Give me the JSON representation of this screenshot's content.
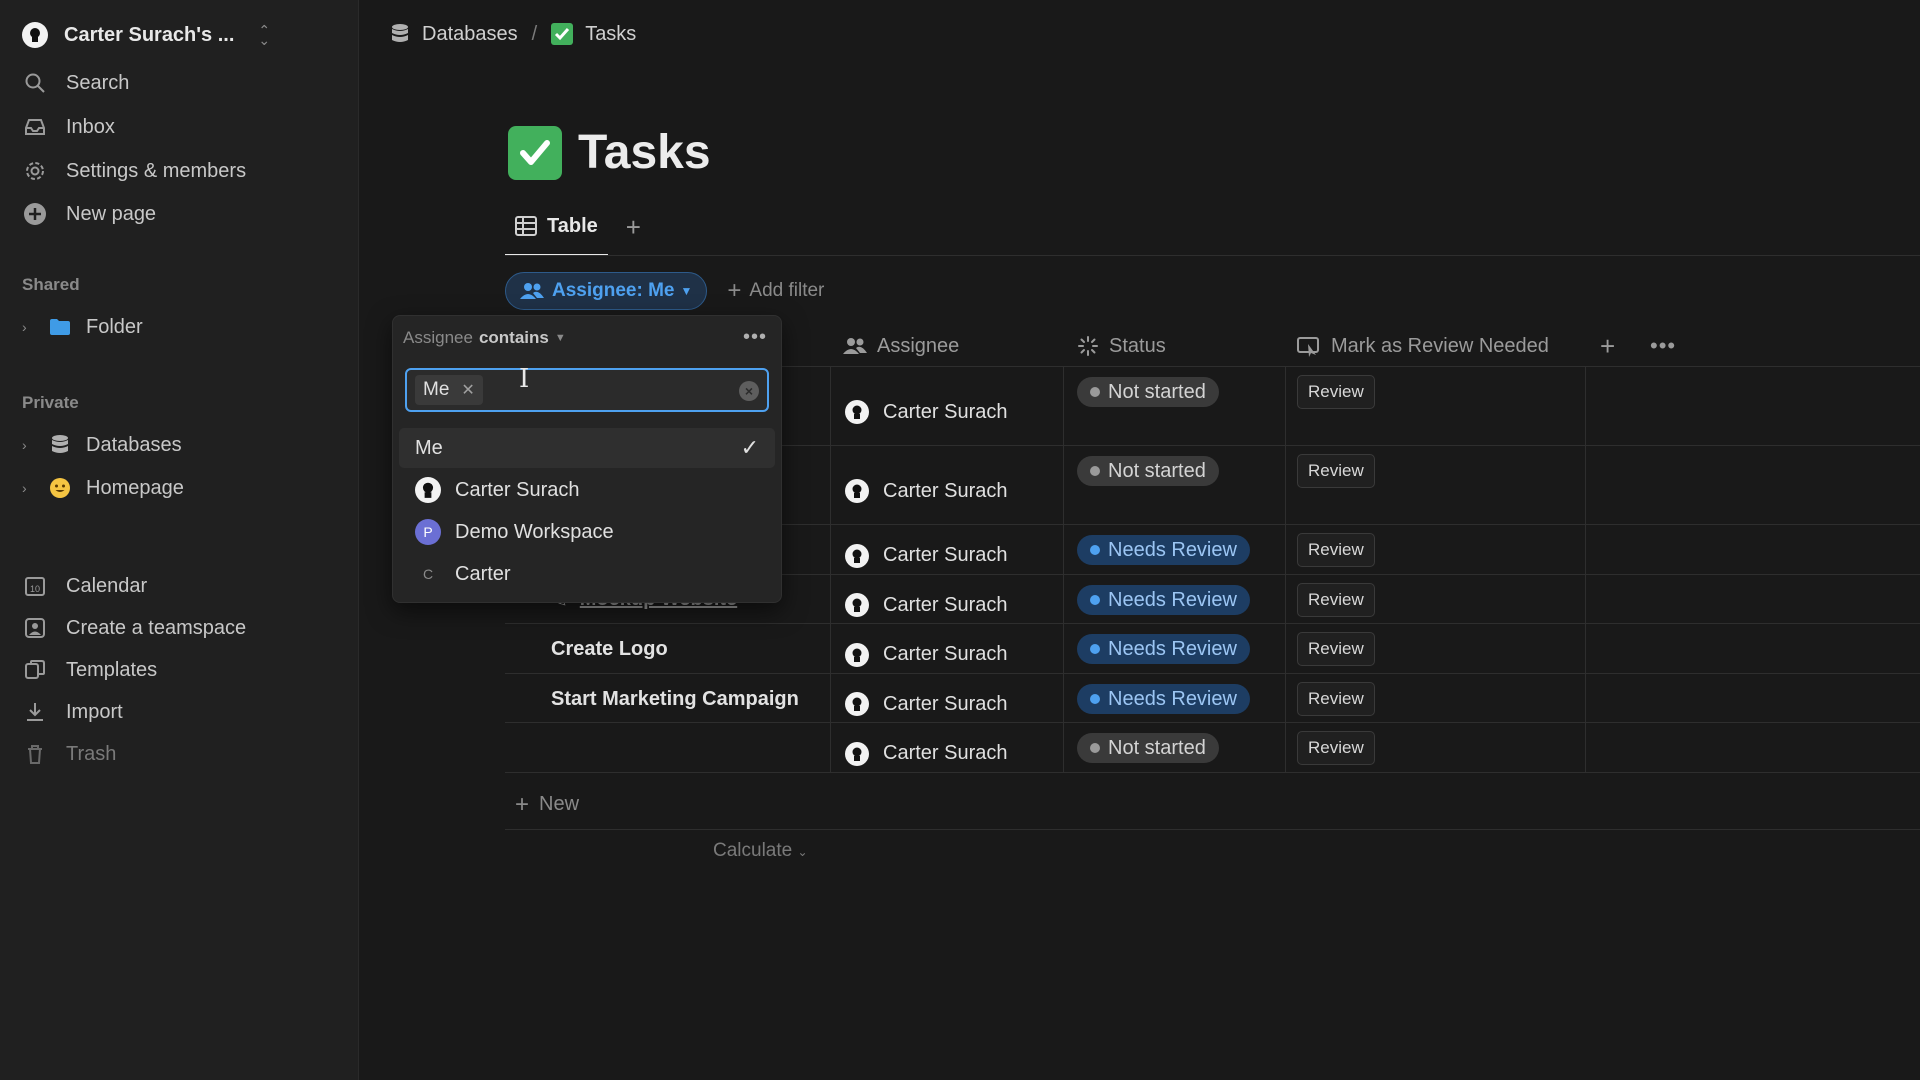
{
  "sidebar": {
    "workspace_name": "Carter Surach's ...",
    "nav": [
      {
        "label": "Search",
        "icon": "search-icon"
      },
      {
        "label": "Inbox",
        "icon": "inbox-icon"
      },
      {
        "label": "Settings & members",
        "icon": "gear-icon"
      },
      {
        "label": "New page",
        "icon": "plus-circle-icon"
      }
    ],
    "shared_label": "Shared",
    "shared_items": [
      {
        "label": "Folder",
        "icon": "folder-icon"
      }
    ],
    "private_label": "Private",
    "private_items": [
      {
        "label": "Databases",
        "icon": "database-icon"
      },
      {
        "label": "Homepage",
        "icon": "smiley-icon"
      }
    ],
    "bottom_nav": [
      {
        "label": "Calendar",
        "icon": "calendar-icon"
      },
      {
        "label": "Create a teamspace",
        "icon": "teamspace-icon"
      },
      {
        "label": "Templates",
        "icon": "templates-icon"
      },
      {
        "label": "Import",
        "icon": "import-icon"
      },
      {
        "label": "Trash",
        "icon": "trash-icon"
      }
    ]
  },
  "breadcrumb": {
    "items": [
      "Databases",
      "Tasks"
    ],
    "separator": "/"
  },
  "page": {
    "title": "Tasks",
    "tabs": [
      {
        "label": "Table"
      }
    ],
    "filter_chip": "Assignee: Me",
    "add_filter": "Add filter"
  },
  "table": {
    "columns": [
      "Assignee",
      "Status",
      "Mark as Review Needed"
    ],
    "rows": [
      {
        "name": "",
        "assignee": "Carter Surach",
        "status": "Not started",
        "review": "Review"
      },
      {
        "name": "",
        "assignee": "Carter Surach",
        "status": "Not started",
        "review": "Review"
      },
      {
        "name": "",
        "assignee": "Carter Surach",
        "status": "Needs Review",
        "review": "Review"
      },
      {
        "name": "Mockup Website",
        "assignee": "Carter Surach",
        "status": "Needs Review",
        "review": "Review"
      },
      {
        "name": "Create Logo",
        "assignee": "Carter Surach",
        "status": "Needs Review",
        "review": "Review"
      },
      {
        "name": "Start Marketing Campaign",
        "assignee": "Carter Surach",
        "status": "Needs Review",
        "review": "Review"
      },
      {
        "name": "",
        "assignee": "Carter Surach",
        "status": "Not started",
        "review": "Review"
      }
    ],
    "new_label": "New",
    "calculate_label": "Calculate"
  },
  "popover": {
    "property": "Assignee",
    "operator": "contains",
    "token": "Me",
    "options": [
      {
        "label": "Me",
        "selected": true
      },
      {
        "label": "Carter Surach",
        "avatar": ""
      },
      {
        "label": "Demo Workspace",
        "avatar": "P"
      },
      {
        "label": "Carter",
        "avatar": "C"
      }
    ]
  },
  "colors": {
    "accent": "#4ea1f0",
    "needs_review_bg": "#1d3d63",
    "not_started_bg": "#3a3a3a",
    "check_green": "#42b05c"
  }
}
